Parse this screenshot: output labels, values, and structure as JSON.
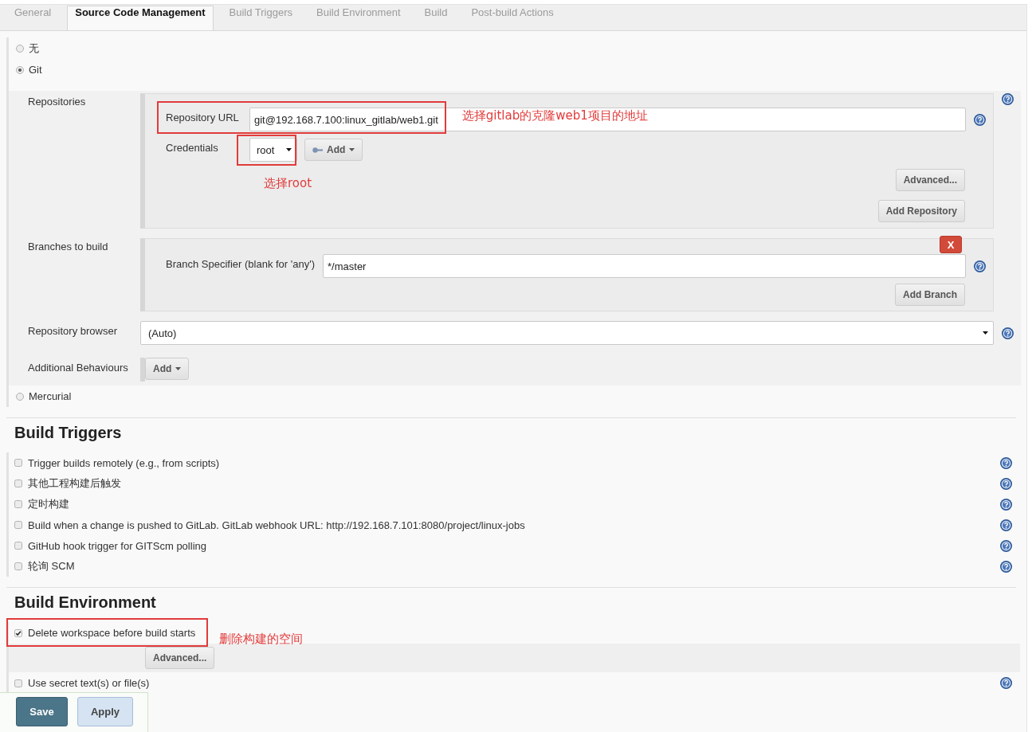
{
  "tabs": [
    {
      "label": "General",
      "selected": false
    },
    {
      "label": "Source Code Management",
      "selected": true
    },
    {
      "label": "Build Triggers",
      "selected": false
    },
    {
      "label": "Build Environment",
      "selected": false
    },
    {
      "label": "Build",
      "selected": false
    },
    {
      "label": "Post-build Actions",
      "selected": false
    }
  ],
  "scm": {
    "options": [
      {
        "label": "无",
        "selected": false
      },
      {
        "label": "Git",
        "selected": true,
        "config": {
          "repositories": {
            "label": "Repositories",
            "help": true,
            "url": {
              "label": "Repository URL",
              "value": "git@192.168.7.100:linux_gitlab/web1.git",
              "annotation": "选择gitlab的克隆web1项目的地址",
              "help": true
            },
            "credentials": {
              "label": "Credentials",
              "value": "root",
              "annotation": "选择root",
              "add_button": "Add"
            },
            "advanced_button": "Advanced...",
            "add_repository_button": "Add Repository"
          },
          "branches": {
            "label": "Branches to build",
            "delete_button": "X",
            "specifier": {
              "label": "Branch Specifier (blank for 'any')",
              "value": "*/master",
              "help": true
            },
            "add_branch_button": "Add Branch"
          },
          "repository_browser": {
            "label": "Repository browser",
            "value": "(Auto)",
            "help": true
          },
          "additional_behaviours": {
            "label": "Additional Behaviours",
            "add_button": "Add"
          }
        }
      },
      {
        "label": "Mercurial",
        "selected": false
      }
    ]
  },
  "build_triggers": {
    "title": "Build Triggers",
    "items": [
      {
        "label": "Trigger builds remotely (e.g., from scripts)",
        "checked": false,
        "help": true
      },
      {
        "label": "其他工程构建后触发",
        "checked": false,
        "help": true
      },
      {
        "label": "定时构建",
        "checked": false,
        "help": true
      },
      {
        "label": "Build when a change is pushed to GitLab. GitLab webhook URL: http://192.168.7.101:8080/project/linux-jobs",
        "checked": false,
        "help": true
      },
      {
        "label": "GitHub hook trigger for GITScm polling",
        "checked": false,
        "help": true
      },
      {
        "label": "轮询 SCM",
        "checked": false,
        "help": true
      }
    ]
  },
  "build_environment": {
    "title": "Build Environment",
    "items": [
      {
        "label": "Delete workspace before build starts",
        "checked": true,
        "annotation": "删除构建的空间",
        "advanced_button": "Advanced..."
      },
      {
        "label": "Use secret text(s) or file(s)",
        "checked": false,
        "help": true
      }
    ]
  },
  "save_bar": {
    "buttons": [
      {
        "label": "Save",
        "kind": "primary"
      },
      {
        "label": "Apply",
        "kind": "secondary"
      }
    ]
  }
}
